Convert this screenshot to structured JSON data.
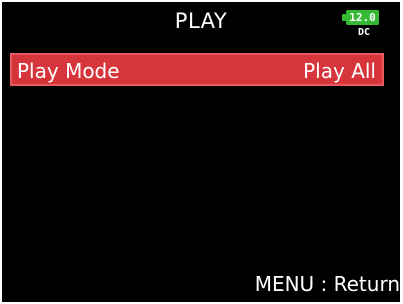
{
  "header": {
    "title": "PLAY"
  },
  "power": {
    "voltage": "12.0",
    "source": "DC",
    "icon": "battery-icon",
    "color": "#35b935"
  },
  "menu": {
    "items": [
      {
        "label": "Play Mode",
        "value": "Play All",
        "selected": true
      }
    ],
    "highlight_color": "#d5353b"
  },
  "footer": {
    "hint": "MENU : Return"
  }
}
